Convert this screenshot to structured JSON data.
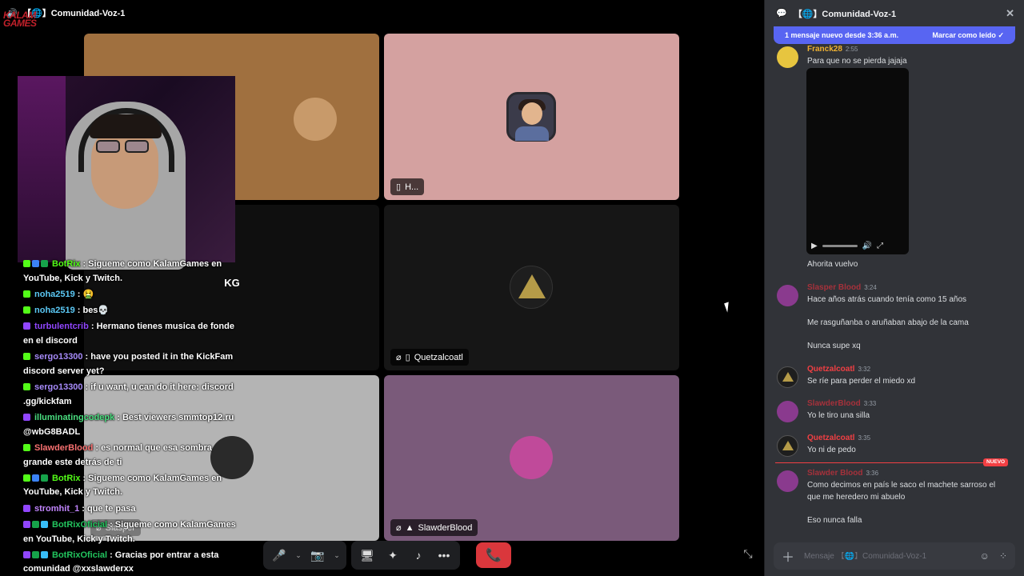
{
  "stage": {
    "channel_title": "【🌐】Comunidad-Voz-1",
    "brand": "KALAM GAMES",
    "tiles": [
      {
        "name": ""
      },
      {
        "name": "H..."
      },
      {
        "name": ""
      },
      {
        "name": "Quetzalcoatl"
      },
      {
        "name": "Slasper"
      },
      {
        "name": "SlawderBlood"
      }
    ],
    "logo_text": "KG"
  },
  "overlay_chat": [
    {
      "user": "BotRix",
      "user_color": "#53fc18",
      "text": ": Sigueme como KalamGames en YouTube, Kick y Twitch.",
      "badges": [
        "kick",
        "blue",
        "grn"
      ]
    },
    {
      "user": "noha2519",
      "user_color": "#5bc8f5",
      "text": ": 🤮",
      "badges": [
        "kick"
      ]
    },
    {
      "user": "noha2519",
      "user_color": "#5bc8f5",
      "text": ": bes💀",
      "badges": [
        "kick"
      ]
    },
    {
      "user": "turbulentcrib",
      "user_color": "#9146ff",
      "text": ": Hermano tienes musica de fonde en el discord",
      "badges": [
        "twitch"
      ]
    },
    {
      "user": "sergo13300",
      "user_color": "#a78bfa",
      "text": ": have you posted it in the KickFam discord server yet?",
      "badges": [
        "kick"
      ]
    },
    {
      "user": "sergo13300",
      "user_color": "#a78bfa",
      "text": ": if u want, u can do it here: discord .gg/kickfam",
      "badges": [
        "kick"
      ]
    },
    {
      "user": "illuminatingcodepk",
      "user_color": "#4ade80",
      "text": ": Best viewers smmtop12.ru @wbG8BADL",
      "badges": [
        "twitch"
      ]
    },
    {
      "user": "SlawderBlood",
      "user_color": "#f87171",
      "text": ": es normal que esa sombra grande este detrás de ti",
      "badges": [
        "kick"
      ]
    },
    {
      "user": "BotRix",
      "user_color": "#53fc18",
      "text": ": Sigueme como KalamGames en YouTube, Kick y Twitch.",
      "badges": [
        "kick",
        "blue",
        "grn"
      ]
    },
    {
      "user": "stromhit_1",
      "user_color": "#c084fc",
      "text": ": que te pasa",
      "badges": [
        "twitch"
      ]
    },
    {
      "user": "BotRixOficial",
      "user_color": "#22c55e",
      "text": ": Sigueme como KalamGames en YouTube, Kick y Twitch.",
      "badges": [
        "twitch",
        "grn",
        "teal"
      ]
    },
    {
      "user": "BotRixOficial",
      "user_color": "#22c55e",
      "text": ": Gracias por entrar a esta comunidad @xxslawderxx",
      "badges": [
        "twitch",
        "grn",
        "teal"
      ]
    }
  ],
  "controls": {
    "mic": "🎤",
    "camera": "📷",
    "share": "🖥",
    "activities": "✦",
    "soundboard": "♪",
    "more": "•••",
    "hangup": "📞"
  },
  "panel": {
    "title": "【🌐】Comunidad-Voz-1",
    "close": "✕",
    "banner_left": "1 mensaje nuevo desde 3:36 a.m.",
    "banner_right": "Marcar como leído",
    "new_tag": "NUEVO",
    "messages": [
      {
        "author": "Franck28",
        "color": "#f0b232",
        "time": "2:55",
        "lines": [
          "Para que no se pierda jajaja"
        ]
      },
      {
        "author": "",
        "color": "#dbdee1",
        "time": "",
        "lines": [
          "Ahorita vuelvo"
        ]
      },
      {
        "author": "Slasper Blood",
        "color": "#a6313b",
        "time": "3:24",
        "lines": [
          "Hace años atrás cuando tenía como 15 años",
          "Me rasguñanba o aruñaban abajo de la cama",
          "Nunca supe xq"
        ]
      },
      {
        "author": "Quetzalcoatl",
        "color": "#f23f43",
        "time": "3:32",
        "lines": [
          "Se ríe para perder el miedo xd"
        ]
      },
      {
        "author": "SlawderBlood",
        "color": "#a6313b",
        "time": "3:33",
        "lines": [
          "Yo le tiro una silla"
        ]
      },
      {
        "author": "Quetzalcoatl",
        "color": "#f23f43",
        "time": "3:35",
        "lines": [
          "Yo ni de pedo"
        ]
      },
      {
        "author": "Slawder Blood",
        "color": "#a6313b",
        "time": "3:36",
        "lines": [
          "Como decimos en país le saco el machete sarroso el",
          "que me heredero mi abuelo",
          "Eso nunca falla"
        ]
      }
    ],
    "composer_placeholder": "Mensaje 【🌐】Comunidad-Voz-1"
  }
}
